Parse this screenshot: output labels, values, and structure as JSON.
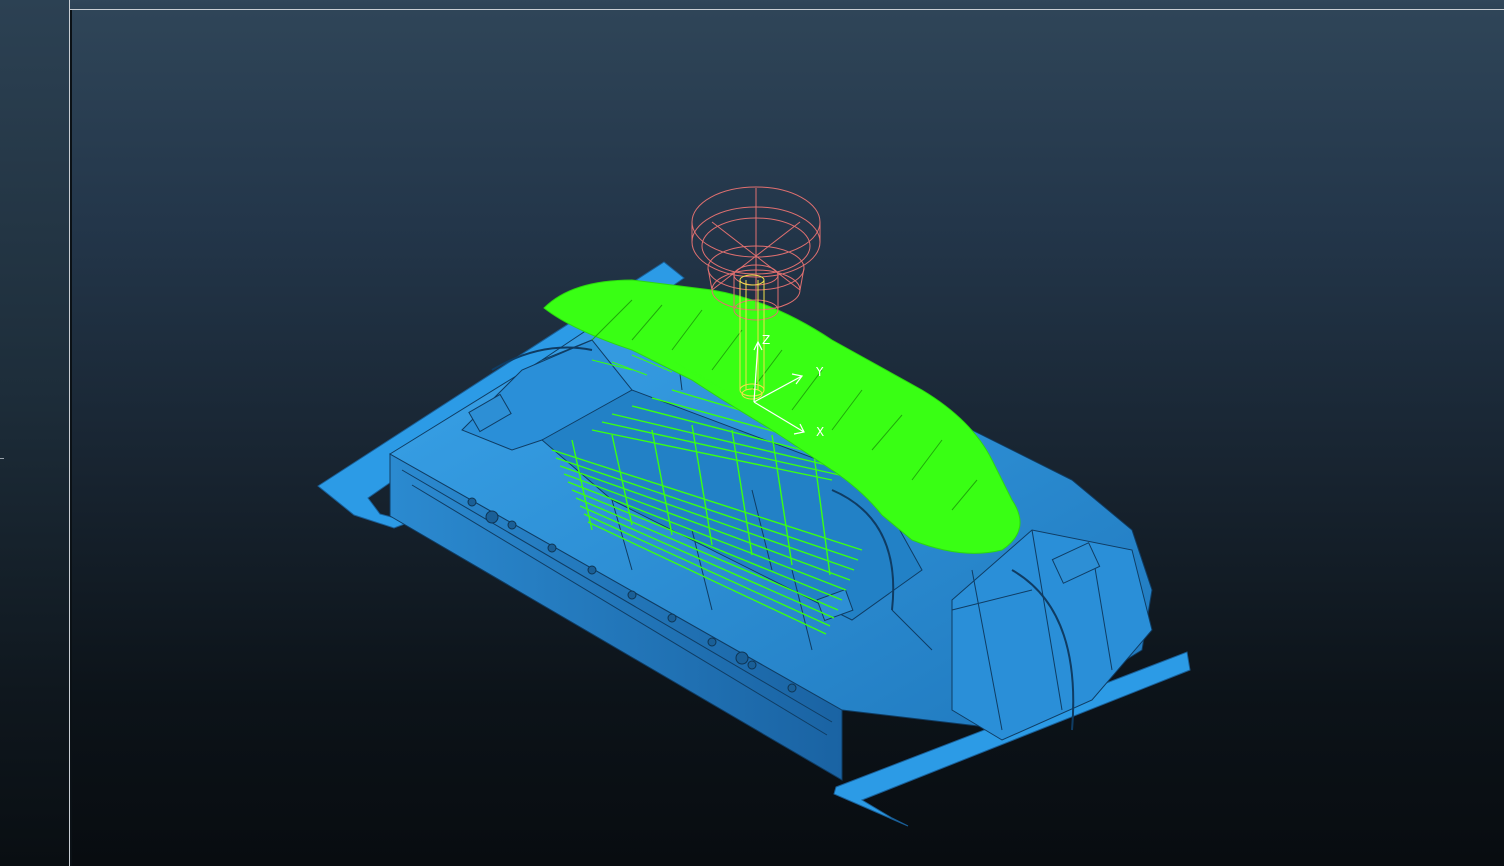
{
  "viewport": {
    "background_top": "#2f4558",
    "background_bottom": "#080c10",
    "part_color": "#2d8fd5",
    "toolpath_color": "#39ff14",
    "tool_holder_color": "#e07070",
    "cutter_color": "#f2e14a"
  },
  "triad": {
    "z_label": "Z",
    "y_label": "Y",
    "x_label": "X"
  }
}
